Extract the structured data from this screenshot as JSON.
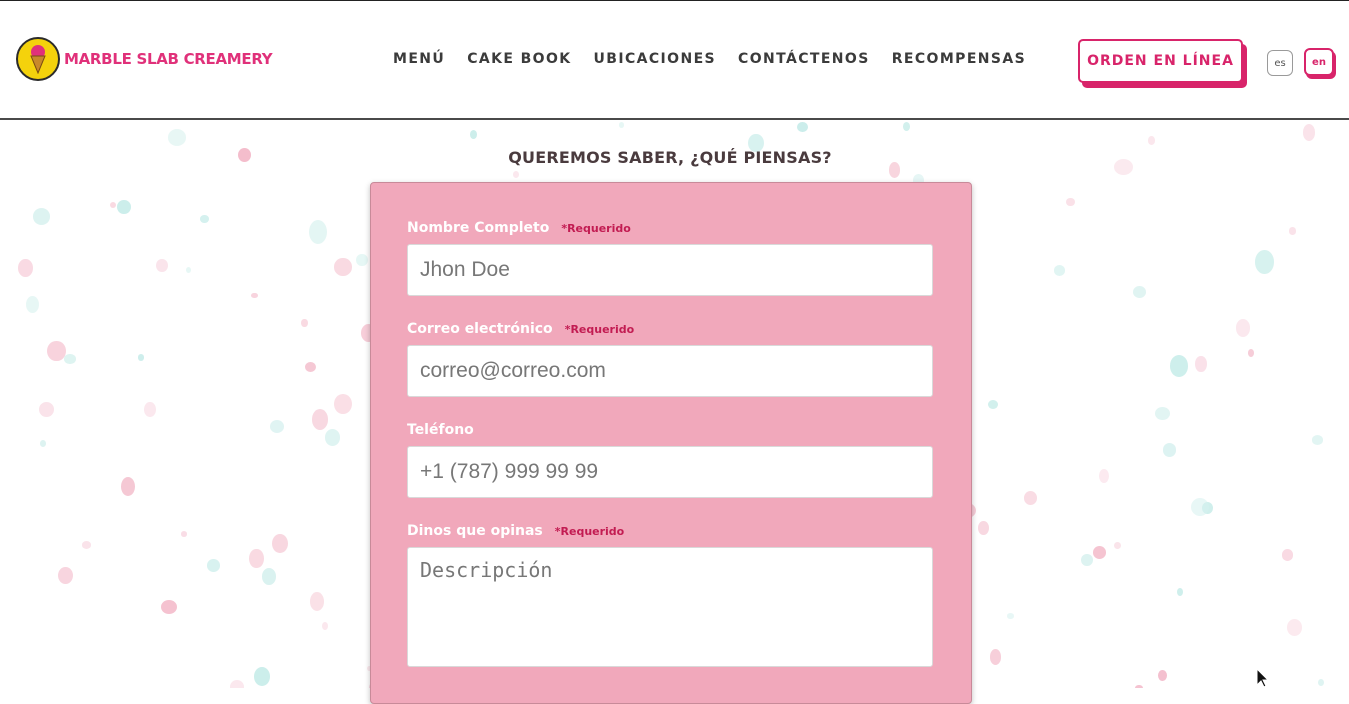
{
  "brand": {
    "name": "MARBLE SLAB CREAMERY",
    "logo_icon": "ice-cream-cone-badge",
    "color": "#e0317a"
  },
  "nav": {
    "items": [
      {
        "label": "MENÚ"
      },
      {
        "label": "CAKE BOOK"
      },
      {
        "label": "UBICACIONES"
      },
      {
        "label": "CONTÁCTENOS"
      },
      {
        "label": "RECOMPENSAS"
      }
    ]
  },
  "header": {
    "order_button": "ORDEN EN LÍNEA",
    "lang_es": "es",
    "lang_en": "en"
  },
  "form": {
    "title": "QUEREMOS SABER, ¿QUÉ PIENSAS?",
    "required_text": "*Requerido",
    "name": {
      "label": "Nombre Completo",
      "placeholder": "Jhon Doe"
    },
    "email": {
      "label": "Correo electrónico",
      "placeholder": "correo@correo.com"
    },
    "phone": {
      "label": "Teléfono",
      "placeholder": "+1 (787) 999 99 99"
    },
    "message": {
      "label": "Dinos que opinas",
      "placeholder": "Descripción"
    }
  },
  "colors": {
    "accent": "#d8246a",
    "card": "#f1a8bb",
    "required": "#c21c52"
  }
}
